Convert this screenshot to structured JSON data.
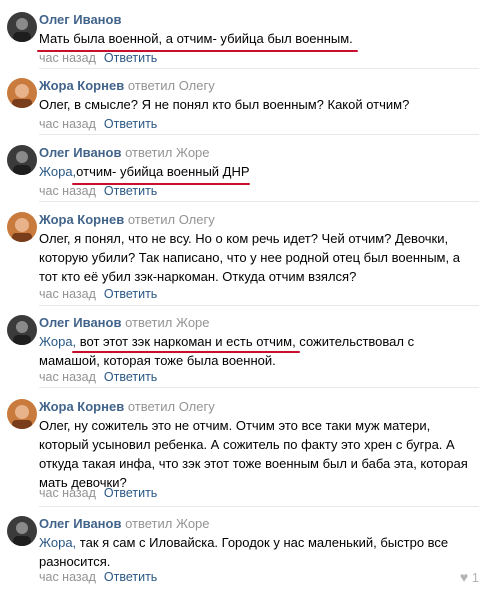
{
  "comments": [
    {
      "author": "Олег Иванов",
      "reply_to": "",
      "addressee": "",
      "text": "Мать была военной, а отчим- убийца был военным.",
      "date": "час назад",
      "reply_label": "Ответить"
    },
    {
      "author": "Жора Корнев",
      "reply_to": "ответил Олегу",
      "addressee": "",
      "text": "Олег, в смысле? Я не понял кто был военным? Какой отчим?",
      "date": "час назад",
      "reply_label": "Ответить"
    },
    {
      "author": "Олег Иванов",
      "reply_to": "ответил Жоре",
      "addressee": "Жора,",
      "text": "отчим- убийца военный ДНР",
      "date": "час назад",
      "reply_label": "Ответить"
    },
    {
      "author": "Жора Корнев",
      "reply_to": "ответил Олегу",
      "addressee": "",
      "text": "Олег, я понял, что не всу. Но о ком речь идет? Чей отчим? Девочки, которую убили? Так написано, что у нее родной отец был военным, а тот кто её убил зэк-наркоман. Откуда отчим взялся?",
      "date": "час назад",
      "reply_label": "Ответить"
    },
    {
      "author": "Олег Иванов",
      "reply_to": "ответил Жоре",
      "addressee": "Жора,",
      "text": " вот этот зэк наркоман и есть отчим, сожительствовал с мамашой, которая тоже была военной.",
      "date": "час назад",
      "reply_label": "Ответить"
    },
    {
      "author": "Жора Корнев",
      "reply_to": "ответил Олегу",
      "addressee": "",
      "text": "Олег, ну сожитель это не отчим. Отчим это все таки муж матери, который усыновил ребенка. А сожитель по факту это хрен с бугра. А откуда такая инфа, что зэк этот тоже военным был и баба эта, которая мать девочки?",
      "date": "час назад",
      "reply_label": "Ответить"
    },
    {
      "author": "Олег Иванов",
      "reply_to": "ответил Жоре",
      "addressee": "Жора,",
      "text": " так я сам с Иловайска. Городок у нас маленький, быстро все разносится.",
      "date": "час назад",
      "reply_label": "Ответить",
      "likes": "1"
    }
  ],
  "colors": {
    "author": "#42648b",
    "link": "#2a5885",
    "muted": "#939393",
    "highlight_underline": "#c8102e"
  },
  "icons": {
    "like": "heart-icon"
  }
}
